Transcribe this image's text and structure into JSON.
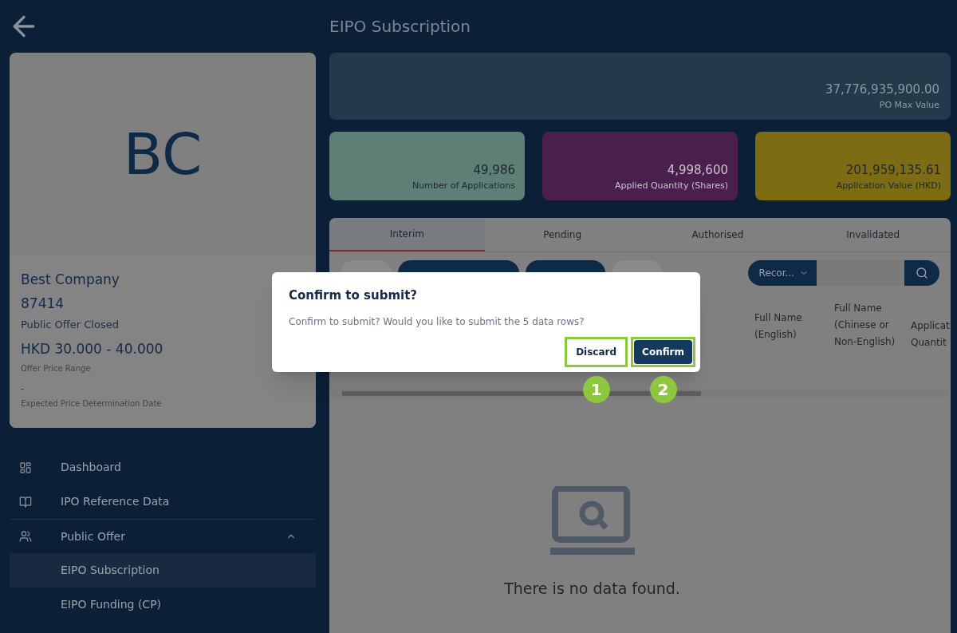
{
  "header": {
    "title": "EIPO Subscription"
  },
  "company": {
    "initials": "BC",
    "name": "Best Company",
    "code": "87414",
    "status": "Public Offer Closed",
    "price_range": "HKD 30.000 - 40.000",
    "price_range_label": "Offer Price Range",
    "determination_date": "-",
    "determination_date_label": "Expected Price Determination Date"
  },
  "sidebar": {
    "items": [
      {
        "label": "Dashboard",
        "selected": false
      },
      {
        "label": "IPO Reference Data",
        "selected": false
      },
      {
        "label": "Public Offer",
        "expanded": true,
        "selected": false,
        "children": [
          {
            "label": "EIPO Subscription",
            "selected": true
          },
          {
            "label": "EIPO Funding (CP)",
            "selected": false
          }
        ]
      }
    ]
  },
  "max_value": {
    "value": "37,776,935,900.00",
    "label": "PO Max Value"
  },
  "stats": [
    {
      "value": "49,986",
      "label": "Number of Applications",
      "color": "#5e7f75"
    },
    {
      "value": "4,998,600",
      "label": "Applied Quantity (Shares)",
      "color": "#4a1f4e"
    },
    {
      "value": "201,959,135.61",
      "label": "Application Value (HKD)",
      "color": "#7e6c14"
    }
  ],
  "tabs": [
    {
      "label": "Interim",
      "selected": true
    },
    {
      "label": "Pending",
      "selected": false
    },
    {
      "label": "Authorised",
      "selected": false
    },
    {
      "label": "Invalidated",
      "selected": false
    }
  ],
  "toolbar": {
    "filter": "Recor..."
  },
  "columns": [
    "Full Name (English)",
    "Full Name (Chinese or Non-English)",
    "Applicat Quantit"
  ],
  "empty_message": "There is no data found.",
  "dialog": {
    "title": "Confirm to submit?",
    "message": "Confirm to submit? Would you like to submit the 5 data rows?",
    "buttons": [
      {
        "label": "Discard",
        "kind": "text",
        "callout": "1"
      },
      {
        "label": "Confirm",
        "kind": "primary",
        "callout": "2"
      }
    ]
  }
}
